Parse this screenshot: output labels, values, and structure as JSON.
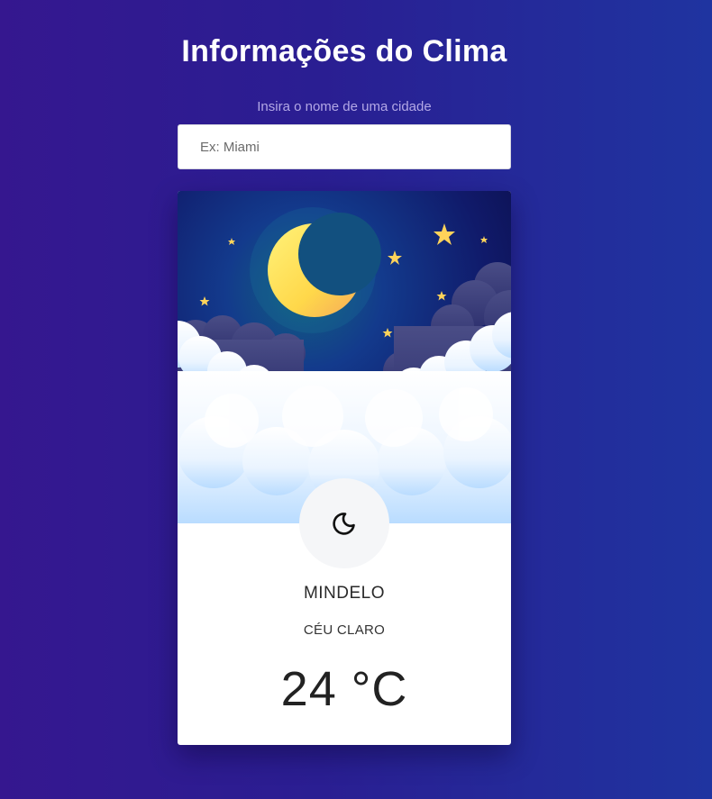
{
  "header": {
    "title": "Informações do Clima"
  },
  "search": {
    "label": "Insira o nome de uma cidade",
    "placeholder": "Ex: Miami",
    "value": ""
  },
  "weather_card": {
    "icon": "moon-icon",
    "city": "MINDELO",
    "description": "CÉU CLARO",
    "temperature": "24 °C",
    "illustration": "night-sky-moon-stars-clouds"
  },
  "colors": {
    "background_start": "#35178f",
    "background_end": "#1f34a0",
    "card": "#ffffff",
    "title": "#ffffff",
    "label": "#b3a8e6"
  }
}
